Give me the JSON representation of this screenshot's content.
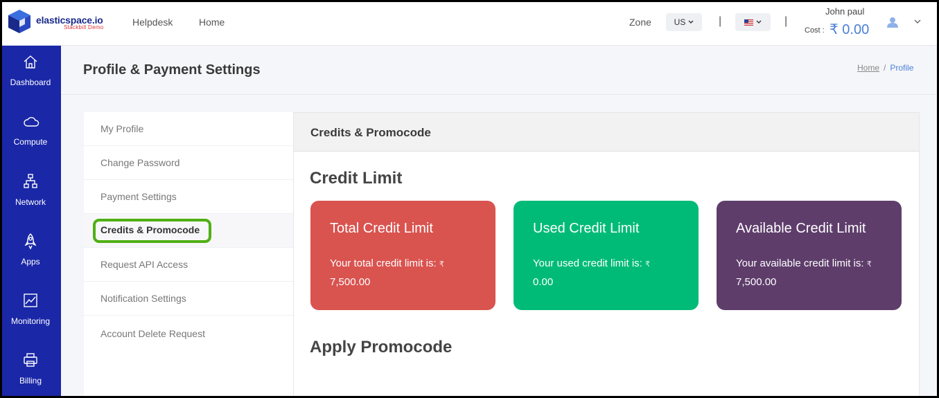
{
  "brand": {
    "name": "elasticspace.io",
    "subtitle": "Stackbill Demo"
  },
  "topnav": {
    "helpdesk": "Helpdesk",
    "home": "Home"
  },
  "zone": {
    "label": "Zone",
    "selected": "US"
  },
  "separator": "|",
  "user": {
    "name": "John paul",
    "cost_label": "Cost :",
    "cost_value": "₹ 0.00"
  },
  "sidebar": {
    "items": [
      {
        "label": "Dashboard",
        "icon": "home-icon"
      },
      {
        "label": "Compute",
        "icon": "cloud-icon"
      },
      {
        "label": "Network",
        "icon": "network-icon"
      },
      {
        "label": "Apps",
        "icon": "rocket-icon"
      },
      {
        "label": "Monitoring",
        "icon": "chart-icon"
      },
      {
        "label": "Billing",
        "icon": "printer-icon"
      }
    ]
  },
  "page": {
    "title": "Profile & Payment Settings",
    "breadcrumb": {
      "home": "Home",
      "sep": "/",
      "current": "Profile"
    }
  },
  "menu": {
    "items": [
      "My Profile",
      "Change Password",
      "Payment Settings",
      "Credits & Promocode",
      "Request API Access",
      "Notification Settings",
      "Account Delete Request"
    ],
    "active_index": 3
  },
  "panel": {
    "header": "Credits & Promocode",
    "credit_section": "Credit Limit",
    "promo_section": "Apply Promocode",
    "cards": [
      {
        "title": "Total Credit Limit",
        "text": "Your total credit limit is:",
        "currency": "₹",
        "amount": "7,500.00",
        "color": "#d9534f"
      },
      {
        "title": "Used Credit Limit",
        "text": "Your used credit limit is:",
        "currency": "₹",
        "amount": "0.00",
        "color": "#00bb77"
      },
      {
        "title": "Available Credit Limit",
        "text": "Your available credit limit is:",
        "currency": "₹",
        "amount": "7,500.00",
        "color": "#5e3d6b"
      }
    ]
  }
}
